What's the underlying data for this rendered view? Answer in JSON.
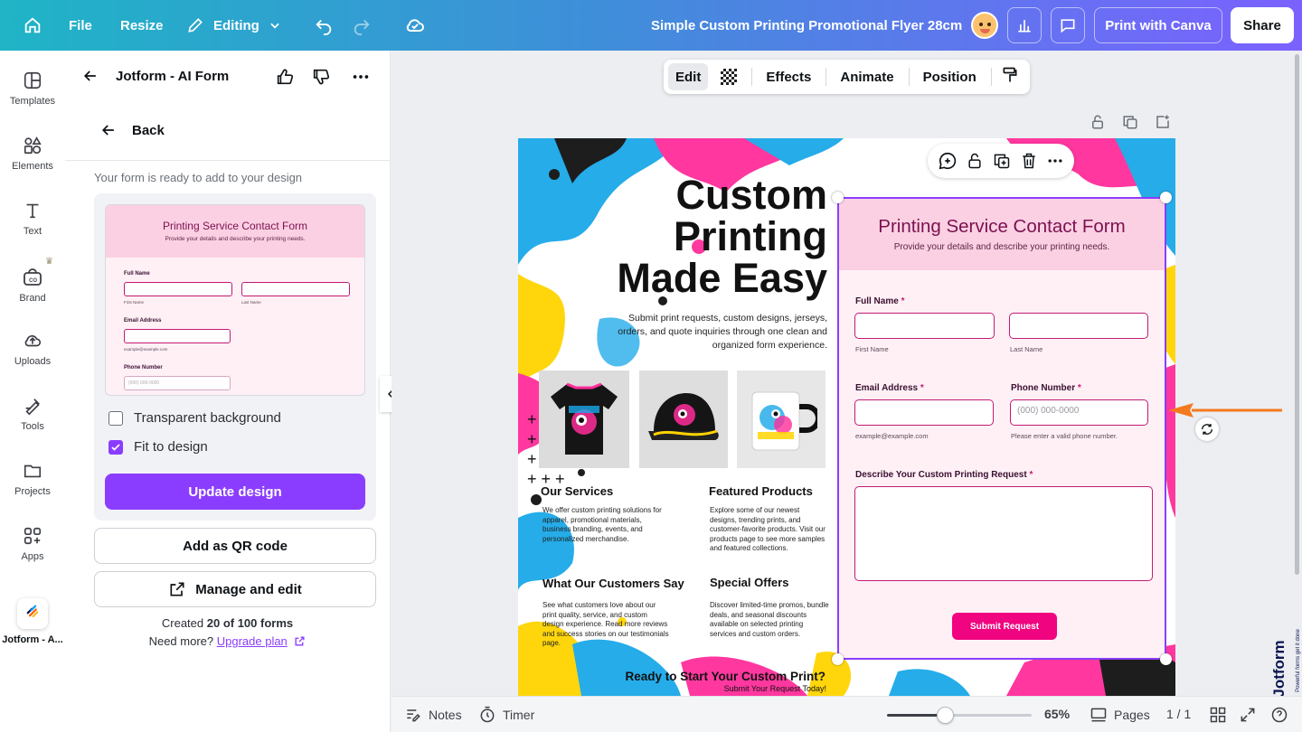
{
  "topbar": {
    "file": "File",
    "resize": "Resize",
    "editing": "Editing",
    "doc_title": "Simple Custom Printing Promotional Flyer 28cm",
    "print_button": "Print with Canva",
    "share_button": "Share"
  },
  "rail": {
    "items": [
      {
        "label": "Templates",
        "icon": "templates-icon"
      },
      {
        "label": "Elements",
        "icon": "elements-icon"
      },
      {
        "label": "Text",
        "icon": "text-icon"
      },
      {
        "label": "Brand",
        "icon": "brand-icon"
      },
      {
        "label": "Uploads",
        "icon": "uploads-icon"
      },
      {
        "label": "Tools",
        "icon": "tools-icon"
      },
      {
        "label": "Projects",
        "icon": "projects-icon"
      },
      {
        "label": "Apps",
        "icon": "apps-icon"
      },
      {
        "label": "Jotform - A...",
        "icon": "jotform-app-icon"
      }
    ]
  },
  "panel": {
    "title": "Jotform - AI Form",
    "back": "Back",
    "ready_text": "Your form is ready to add to your design",
    "preview": {
      "title": "Printing Service Contact Form",
      "subtitle": "Provide your details and describe your printing needs.",
      "full_name": "Full Name",
      "first_name": "First Name",
      "last_name": "Last Name",
      "email": "Email Address",
      "email_hint": "example@example.com",
      "phone": "Phone Number",
      "phone_placeholder": "(000) 000-0000"
    },
    "transparent_bg": "Transparent background",
    "transparent_checked": false,
    "fit_to_design": "Fit to design",
    "fit_checked": true,
    "update_button": "Update design",
    "qr_button": "Add as QR code",
    "manage_button": "Manage and edit",
    "created_prefix": "Created ",
    "created_count": "20 of 100 forms",
    "need_more": "Need more? ",
    "upgrade_link": "Upgrade plan"
  },
  "context_toolbar": {
    "edit": "Edit",
    "effects": "Effects",
    "animate": "Animate",
    "position": "Position"
  },
  "flyer": {
    "headline": [
      "Custom",
      "Printing",
      "Made Easy"
    ],
    "intro": "Submit print requests, custom designs, jerseys, orders, and quote inquiries through one clean and organized form experience.",
    "products": [
      "Monsters Ink jersey",
      "Monsters Ink cap",
      "Monsters Ink mug"
    ],
    "sections": [
      {
        "title": "Our Services",
        "body": "We offer custom printing solutions for apparel, promotional materials, business branding, events, and personalized merchandise."
      },
      {
        "title": "Featured Products",
        "body": "Explore some of our newest designs, trending prints, and customer-favorite products. Visit our products page to see more samples and featured collections."
      },
      {
        "title": "What Our Customers Say",
        "body": "See what customers love about our print quality, service, and custom design experience. Read more reviews and success stories on our testimonials page."
      },
      {
        "title": "Special Offers",
        "body": "Discover limited-time promos, bundle deals, and seasonal discounts available on selected printing services and custom orders."
      }
    ],
    "cta": "Ready to Start Your Custom Print?",
    "cta_sub": "Submit Your Request Today!"
  },
  "form": {
    "title": "Printing Service Contact Form",
    "subtitle": "Provide your details and describe your printing needs.",
    "full_name": "Full Name",
    "first_name": "First Name",
    "last_name": "Last Name",
    "email": "Email Address",
    "email_hint": "example@example.com",
    "phone": "Phone Number",
    "phone_placeholder": "(000) 000-0000",
    "phone_hint": "Please enter a valid phone number.",
    "request": "Describe Your Custom Printing Request",
    "required_mark": "*",
    "submit": "Submit Request"
  },
  "watermark": {
    "brand": "Jotform",
    "tagline": "Powerful forms get it done"
  },
  "footer": {
    "notes": "Notes",
    "timer": "Timer",
    "zoom": "65%",
    "zoom_fraction": 0.4,
    "pages": "Pages",
    "page_count": "1 / 1"
  },
  "colors": {
    "accent_purple": "#8b3dff",
    "form_pink": "#fcd0e3",
    "form_magenta": "#c21a74",
    "submit_pink": "#f0047f",
    "arrow_orange": "#f47a20"
  }
}
